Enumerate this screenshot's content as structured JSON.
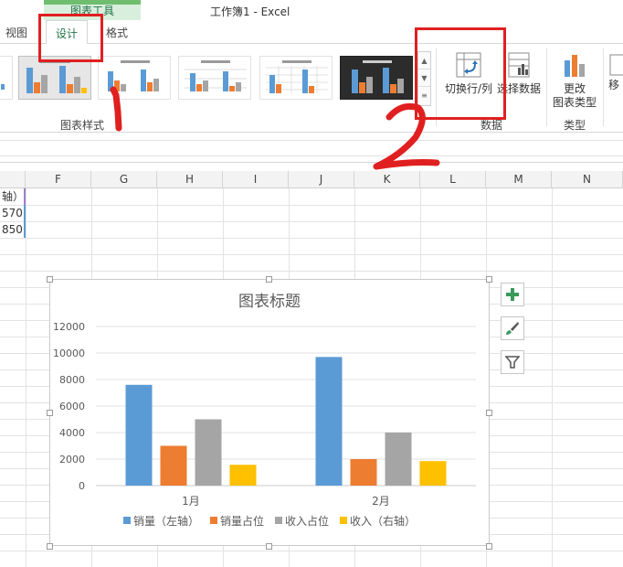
{
  "title_bar": {
    "context_tab": "图表工具",
    "window_title": "工作簿1 - Excel"
  },
  "ribbon_tabs": [
    {
      "label": "视图",
      "active": false
    },
    {
      "label": "设计",
      "active": true
    },
    {
      "label": "格式",
      "active": false
    }
  ],
  "ribbon": {
    "chart_styles_label": "图表样式",
    "switch_row_col": "切换行/列",
    "select_data": "选择数据",
    "data_group_label": "数据",
    "change_chart_type_line1": "更改",
    "change_chart_type_line2": "图表类型",
    "type_group_label": "类型",
    "move_label": "移"
  },
  "columns": [
    "F",
    "G",
    "H",
    "I",
    "J",
    "K",
    "L",
    "M",
    "N"
  ],
  "cells": {
    "e1": "轴）",
    "e2": "570",
    "e3": "850"
  },
  "chart_data": {
    "type": "bar",
    "title": "图表标题",
    "categories": [
      "1月",
      "2月"
    ],
    "series": [
      {
        "name": "销量（左轴）",
        "values": [
          7600,
          9700
        ],
        "color": "#5b9bd5"
      },
      {
        "name": "销量占位",
        "values": [
          3000,
          2000
        ],
        "color": "#ed7d31"
      },
      {
        "name": "收入占位",
        "values": [
          5000,
          4000
        ],
        "color": "#a5a5a5"
      },
      {
        "name": "收入（右轴）",
        "values": [
          1570,
          1850
        ],
        "color": "#ffc000"
      }
    ],
    "ylim": [
      0,
      12000
    ],
    "y_ticks": [
      "0",
      "2000",
      "4000",
      "6000",
      "8000",
      "10000",
      "12000"
    ],
    "grid": true,
    "legend_position": "bottom"
  },
  "annotations": {
    "step1": "1",
    "step2": "2"
  }
}
